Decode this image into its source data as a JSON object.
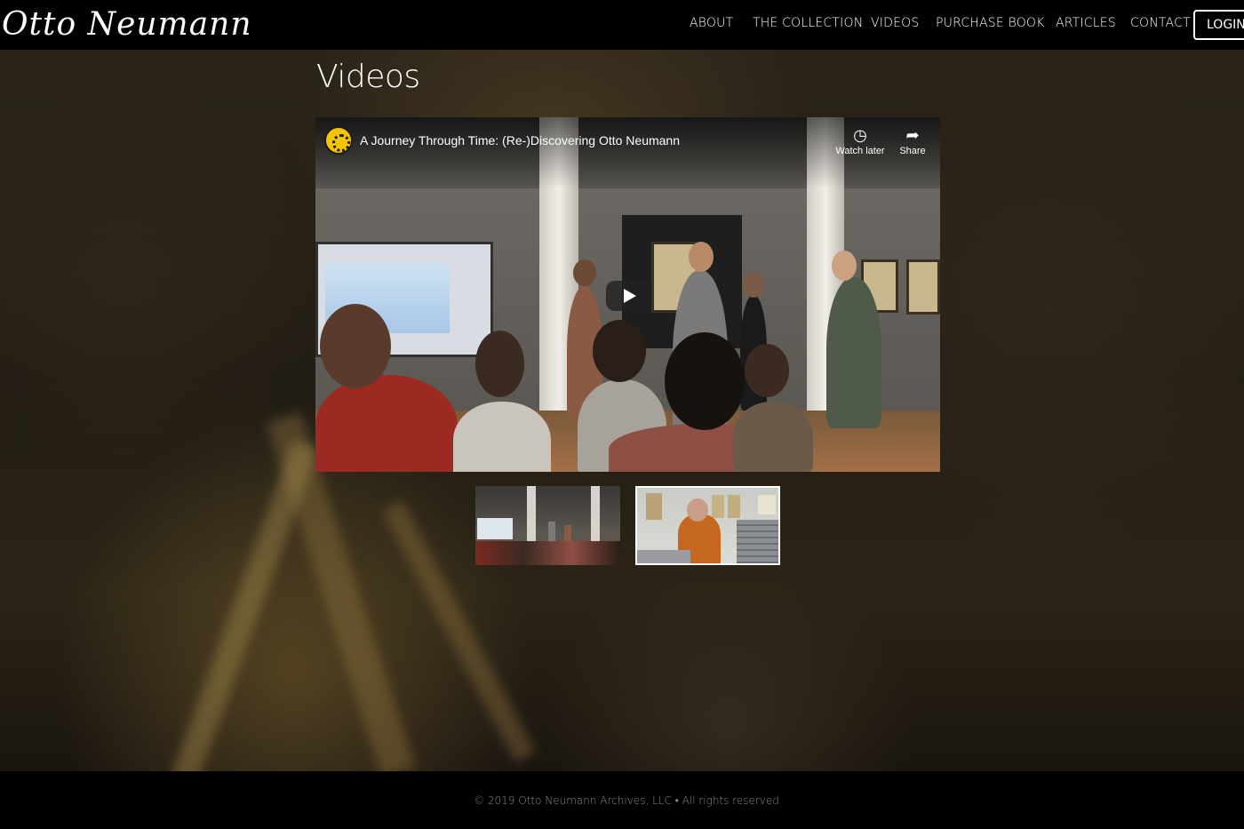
{
  "header": {
    "logo_text": "Otto Neumann",
    "nav": [
      "ABOUT",
      "THE COLLECTION",
      "VIDEOS",
      "PURCHASE BOOK",
      "ARTICLES",
      "CONTACT"
    ],
    "login_label": "LOGIN"
  },
  "main": {
    "title": "Videos",
    "player": {
      "video_title": "A Journey Through Time: (Re-)Discovering Otto Neumann",
      "watch_later_label": "Watch later",
      "share_label": "Share",
      "watch_later_icon": "clock-icon",
      "share_icon": "share-arrow-icon",
      "play_icon": "play-icon",
      "channel_icon": "channel-logo-icon"
    },
    "thumbnails": [
      "video-thumbnail-1",
      "video-thumbnail-2"
    ]
  },
  "footer": {
    "copyright": "© 2019 Otto Neumann Archives, LLC • All rights reserved"
  }
}
